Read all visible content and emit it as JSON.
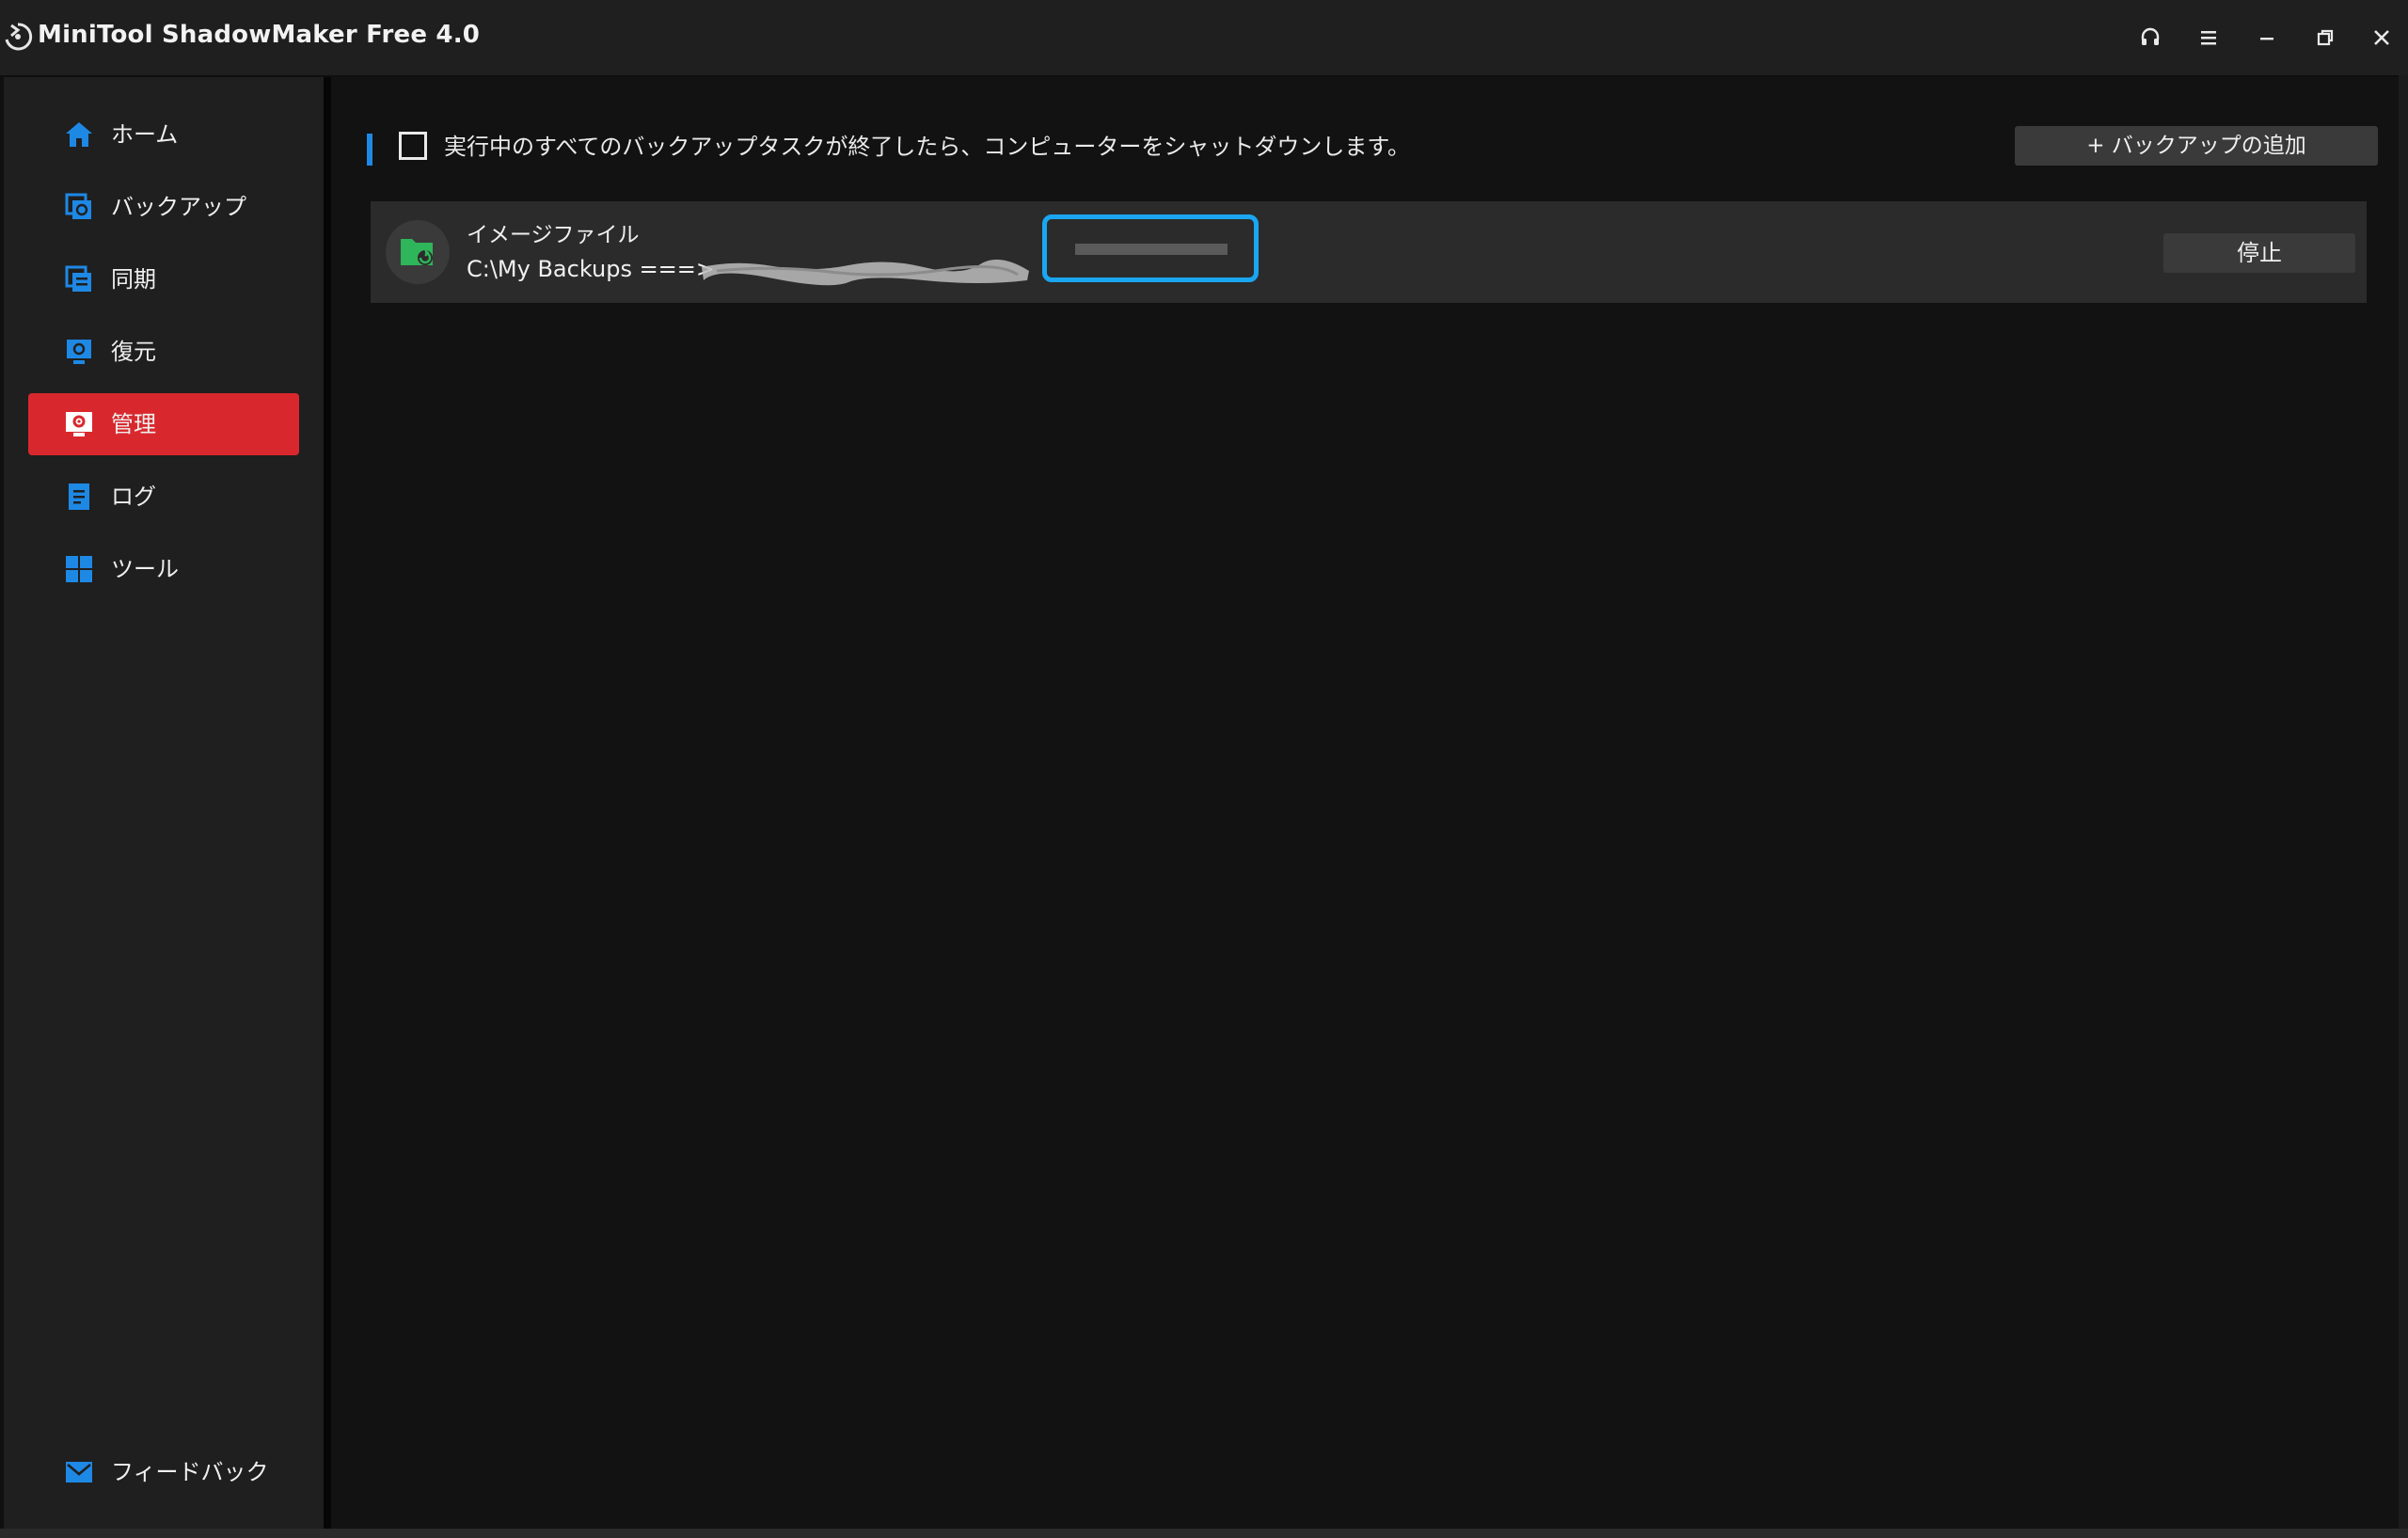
{
  "window": {
    "title": "MiniTool ShadowMaker Free 4.0",
    "controls": [
      "headset-icon",
      "menu-icon",
      "minimize-icon",
      "restore-icon",
      "close-icon"
    ]
  },
  "sidebar": {
    "items": [
      {
        "label": "ホーム",
        "icon": "home-icon"
      },
      {
        "label": "バックアップ",
        "icon": "backup-icon"
      },
      {
        "label": "同期",
        "icon": "sync-icon"
      },
      {
        "label": "復元",
        "icon": "restore-backup-icon"
      },
      {
        "label": "管理",
        "icon": "manage-icon",
        "active": true
      },
      {
        "label": "ログ",
        "icon": "log-icon"
      },
      {
        "label": "ツール",
        "icon": "tools-icon"
      }
    ],
    "feedback": {
      "label": "フィードバック",
      "icon": "mail-icon"
    }
  },
  "main": {
    "shutdown_option": {
      "label": "実行中のすべてのバックアップタスクが終了したら、コンピューターをシャットダウンします。",
      "checked": false
    },
    "add_backup_label": "+ バックアップの追加",
    "task": {
      "title": "イメージファイル",
      "path": "C:\\My Backups ===>",
      "destination_redacted": true,
      "progress": 0.0,
      "stop_label": "停止"
    }
  },
  "colors": {
    "accent_blue": "#1e88e5",
    "active_red": "#d9282d",
    "focus_ring": "#1aa6f0",
    "task_icon_green": "#2fb55a"
  }
}
